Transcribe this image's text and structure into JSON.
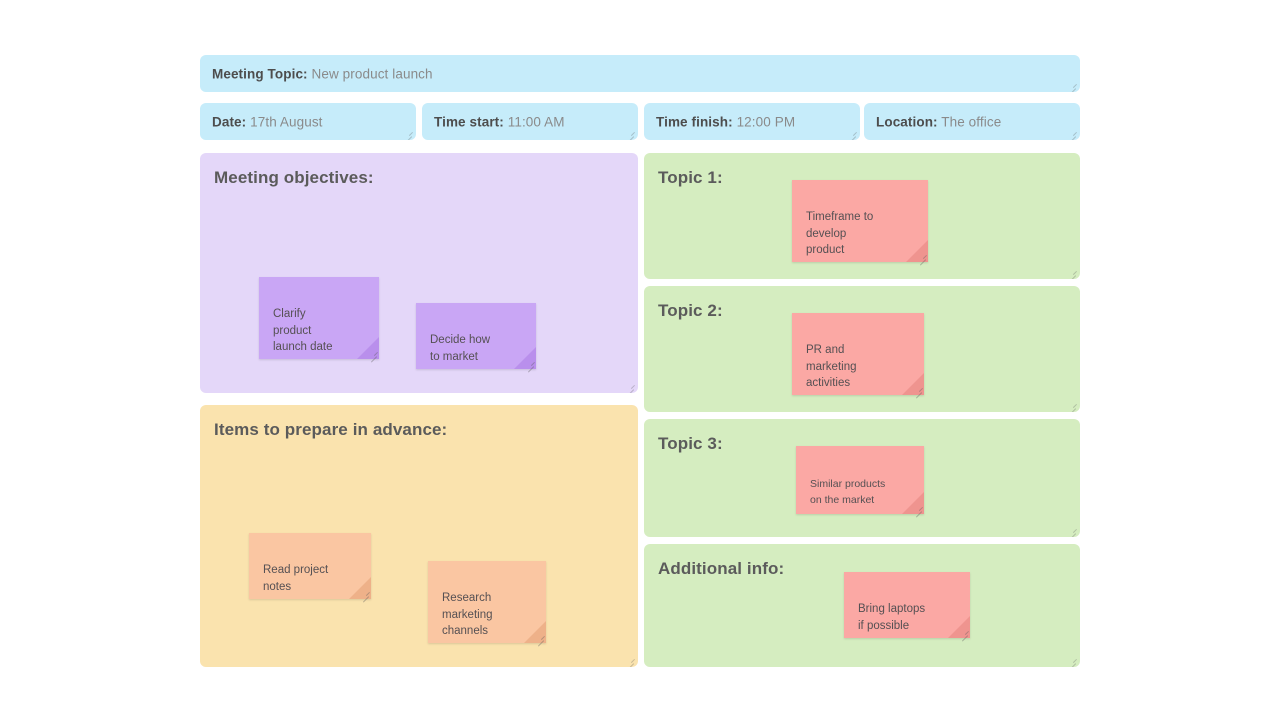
{
  "header": {
    "topic": {
      "label": "Meeting Topic:",
      "value": "New product launch"
    },
    "fields": [
      {
        "label": "Date:",
        "value": "17th August"
      },
      {
        "label": "Time start:",
        "value": "11:00 AM"
      },
      {
        "label": "Time finish:",
        "value": "12:00 PM"
      },
      {
        "label": "Location:",
        "value": "The office"
      }
    ]
  },
  "left_column": {
    "objectives": {
      "title": "Meeting objectives:",
      "notes": [
        {
          "text": "Clarify\nproduct\nlaunch date"
        },
        {
          "text": "Decide how\nto market"
        }
      ]
    },
    "prepare": {
      "title": "Items to prepare in advance:",
      "notes": [
        {
          "text": "Read project\nnotes"
        },
        {
          "text": "Research\nmarketing\nchannels"
        }
      ]
    }
  },
  "right_column": {
    "panels": [
      {
        "title": "Topic 1:",
        "note": "Timeframe to\ndevelop\nproduct"
      },
      {
        "title": "Topic 2:",
        "note": "PR and\nmarketing\nactivities"
      },
      {
        "title": "Topic 3:",
        "note": "Similar products\non the market"
      },
      {
        "title": "Additional info:",
        "note": "Bring laptops\nif possible"
      }
    ]
  },
  "colors": {
    "panel_blue": "#c6ecfa",
    "panel_purple": "#e4d7f9",
    "panel_yellow": "#fae3ae",
    "panel_green": "#d5edc0",
    "note_purple": "#c9a6f5",
    "note_red": "#fba8a4",
    "note_orange": "#fac6a2",
    "heading_text": "#5b5b5b",
    "value_text": "#8a8a8a"
  }
}
